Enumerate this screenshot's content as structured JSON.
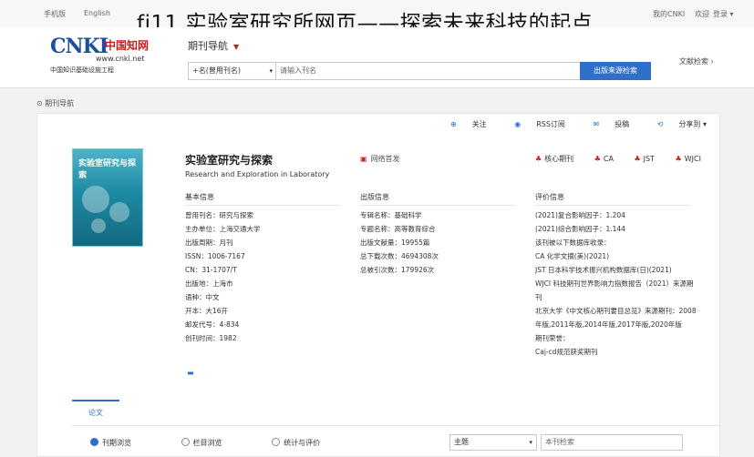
{
  "overlay_title": "fi11 实验室研究所网页——探索未来科技的起点",
  "topbar": {
    "left_items": [
      "手机版",
      "English"
    ],
    "right_items": [
      "我的CNKI",
      "欢迎",
      "登录 ▾"
    ]
  },
  "logo": {
    "brand": "CNKI",
    "brand_cn": "中国知网",
    "url": "www.cnki.net",
    "subtitle": "中国知识基础设施工程"
  },
  "nav": {
    "title": "期刊导航"
  },
  "search": {
    "scope": "+名(曾用刊名)",
    "placeholder": "请输入刊名",
    "button": "出版来源检索",
    "advanced": "文献检索"
  },
  "breadcrumb": "期刊导航",
  "actions": [
    "关注",
    "RSS订阅",
    "投稿",
    "分享到 ▾"
  ],
  "journal": {
    "title": "实验室研究与探索",
    "title_en": "Research and Exploration in Laboratory",
    "site_link": "网络首发",
    "cover_text": "实验室研究与探索",
    "badges": [
      "核心期刊",
      "CA",
      "JST",
      "WJCI"
    ]
  },
  "basic": {
    "heading": "基本信息",
    "rows": [
      "曾用刊名：研究与探索",
      "主办单位：上海交通大学",
      "出版周期：月刊",
      "ISSN：1006-7167",
      "CN：31-1707/T",
      "出版地：上海市",
      "语种：中文",
      "开本：大16开",
      "邮发代号：4-834",
      "创刊时间：1982"
    ]
  },
  "publish": {
    "heading": "出版信息",
    "rows": [
      "专辑名称：基础科学",
      "专题名称：高等教育综合",
      "出版文献量：19955篇",
      "总下载次数：4694308次",
      "总被引次数：179926次"
    ]
  },
  "evaluation": {
    "heading": "评价信息",
    "rows": [
      "(2021)复合影响因子：1.204",
      "(2021)综合影响因子：1.144",
      "该刊被以下数据库收录：",
      "CA 化学文摘(美)(2021)",
      "JST 日本科学技术振兴机构数据库(日)(2021)",
      "WJCI 科技期刊世界影响力指数报告（2021）来源期刊",
      "北京大学《中文核心期刊要目总览》来源期刊：2008年版,2011年版,2014年版,2017年版,2020年版",
      "期刊荣誉：",
      "Caj-cd规范获奖期刊"
    ]
  },
  "tabs": [
    "论文"
  ],
  "filters": {
    "options": [
      "刊期浏览",
      "栏目浏览",
      "统计与评价"
    ],
    "selected": 0,
    "year_select": "主题",
    "search_placeholder": "本刊检索"
  }
}
